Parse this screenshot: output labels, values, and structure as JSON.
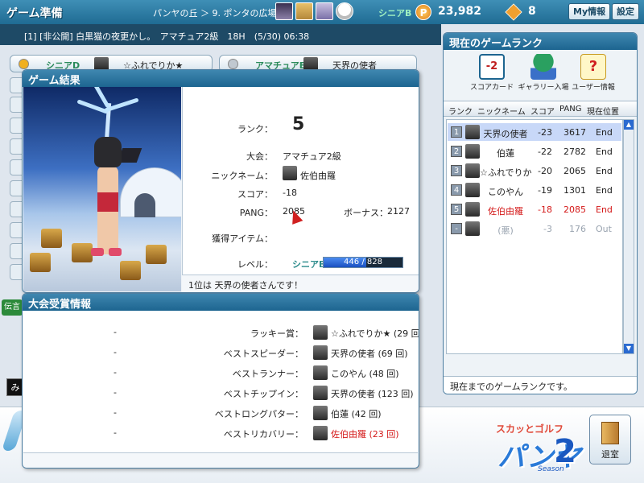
{
  "topbar": {
    "title": "ゲーム準備",
    "breadcrumb": "パンヤの丘 ＞ 9. ポンタの広場",
    "rank_badge": "シニアB",
    "coin_symbol": "P",
    "pang": "23,982",
    "gem_count": "8",
    "myinfo_label": "My情報",
    "settings_label": "設定"
  },
  "announce": "[1] [非公開] 白黒猫の夜更かし。　アマチュア2級　18H　(5/30) 06:38",
  "lobby": {
    "left": {
      "role": "シニアD",
      "name": "☆ふれでりか★"
    },
    "right": {
      "role": "アマチュアE",
      "name": "天界の使者"
    }
  },
  "chat_label": "伝言",
  "chat_hint": "み",
  "result": {
    "header": "ゲーム結果",
    "rank_label": "ランク：",
    "rank_value": "5",
    "tournament_label": "大会：",
    "tournament_value": "アマチュア2級",
    "nickname_label": "ニックネーム：",
    "nickname_value": "佐伯由羅",
    "score_label": "スコア：",
    "score_value": "-18",
    "pang_label": "PANG：",
    "pang_value": "2085",
    "bonus_label": "ボーナス：",
    "bonus_value": "2127",
    "item_label": "獲得アイテム：",
    "level_label": "レベル：",
    "level_badge": "シニアB",
    "exp_text": "446 / 828",
    "exp_ratio": 0.539,
    "note": "1位は 天界の使者さんです！"
  },
  "awards": {
    "header": "大会受賞情報",
    "rows": [
      {
        "dash": "-",
        "title": "ラッキー賞：",
        "winner": "☆ふれでりか★ (29 回)",
        "highlight": false
      },
      {
        "dash": "-",
        "title": "ベストスピーダー：",
        "winner": "天界の使者 (69 回)",
        "highlight": false
      },
      {
        "dash": "-",
        "title": "ベストランナー：",
        "winner": "このやん (48 回)",
        "highlight": false
      },
      {
        "dash": "-",
        "title": "ベストチップイン：",
        "winner": "天界の使者 (123 回)",
        "highlight": false
      },
      {
        "dash": "-",
        "title": "ベストロングパター：",
        "winner": "伯蓮 (42 回)",
        "highlight": false
      },
      {
        "dash": "-",
        "title": "ベストリカバリー：",
        "winner": "佐伯由羅 (23 回)",
        "highlight": true
      }
    ]
  },
  "rank_panel": {
    "header": "現在のゲームランク",
    "icons": [
      {
        "label": "スコアカード",
        "glyph": "-2"
      },
      {
        "label": "ギャラリー入場",
        "glyph": ""
      },
      {
        "label": "ユーザー情報",
        "glyph": "?"
      }
    ],
    "columns": [
      "ランク",
      "ニックネーム",
      "スコア",
      "PANG",
      "現在位置"
    ],
    "rows": [
      {
        "no": "1",
        "name": "天界の使者",
        "score": "-23",
        "pang": "3617",
        "pos": "End",
        "style": "sel"
      },
      {
        "no": "2",
        "name": "伯蓮",
        "score": "-22",
        "pang": "2782",
        "pos": "End",
        "style": ""
      },
      {
        "no": "3",
        "name": "☆ふれでりか★",
        "score": "-20",
        "pang": "2065",
        "pos": "End",
        "style": ""
      },
      {
        "no": "4",
        "name": "このやん",
        "score": "-19",
        "pang": "1301",
        "pos": "End",
        "style": ""
      },
      {
        "no": "5",
        "name": "佐伯由羅",
        "score": "-18",
        "pang": "2085",
        "pos": "End",
        "style": "red"
      },
      {
        "no": "-",
        "name": "(悪)",
        "score": "-3",
        "pang": "176",
        "pos": "Out",
        "style": "dim"
      }
    ],
    "footer": "現在までのゲームランクです。",
    "scroll_up": "▲",
    "scroll_down": "▼"
  },
  "logo": {
    "top": "スカッとゴルフ",
    "main": "パンヤ",
    "num": "2",
    "season": "Season"
  },
  "exit_label": "退室"
}
